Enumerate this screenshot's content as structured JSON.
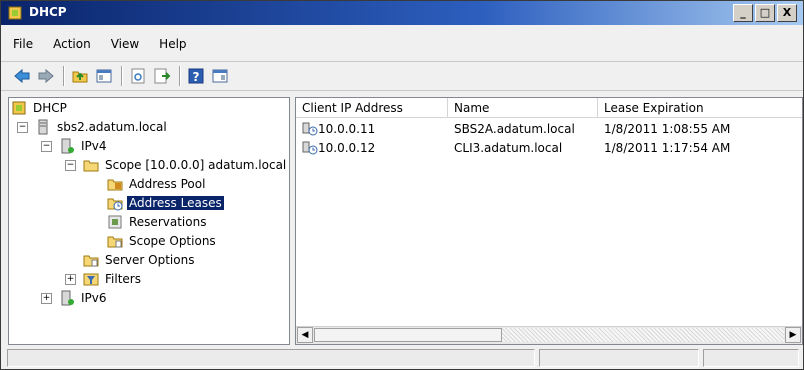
{
  "window": {
    "title": "DHCP",
    "min": "_",
    "max": "□",
    "close": "X"
  },
  "menu": [
    "File",
    "Action",
    "View",
    "Help"
  ],
  "tree": {
    "root": "DHCP",
    "server": "sbs2.adatum.local",
    "ipv4": "IPv4",
    "scope": "Scope [10.0.0.0] adatum.local",
    "address_pool": "Address Pool",
    "address_leases": "Address Leases",
    "reservations": "Reservations",
    "scope_options": "Scope Options",
    "server_options": "Server Options",
    "filters": "Filters",
    "ipv6": "IPv6",
    "selected": "Address Leases"
  },
  "list": {
    "columns": [
      "Client IP Address",
      "Name",
      "Lease Expiration"
    ],
    "rows": [
      [
        "10.0.0.11",
        "SBS2A.adatum.local",
        "1/8/2011 1:08:55 AM"
      ],
      [
        "10.0.0.12",
        "CLI3.adatum.local",
        "1/8/2011 1:17:54 AM"
      ]
    ]
  },
  "colors": {
    "titlebar": "#0a246a",
    "selection": "#0a246a"
  },
  "icons": [
    "back-icon",
    "forward-icon",
    "up-folder-icon",
    "show-hide-tree-icon",
    "refresh-icon",
    "export-list-icon",
    "help-icon",
    "properties-icon"
  ]
}
